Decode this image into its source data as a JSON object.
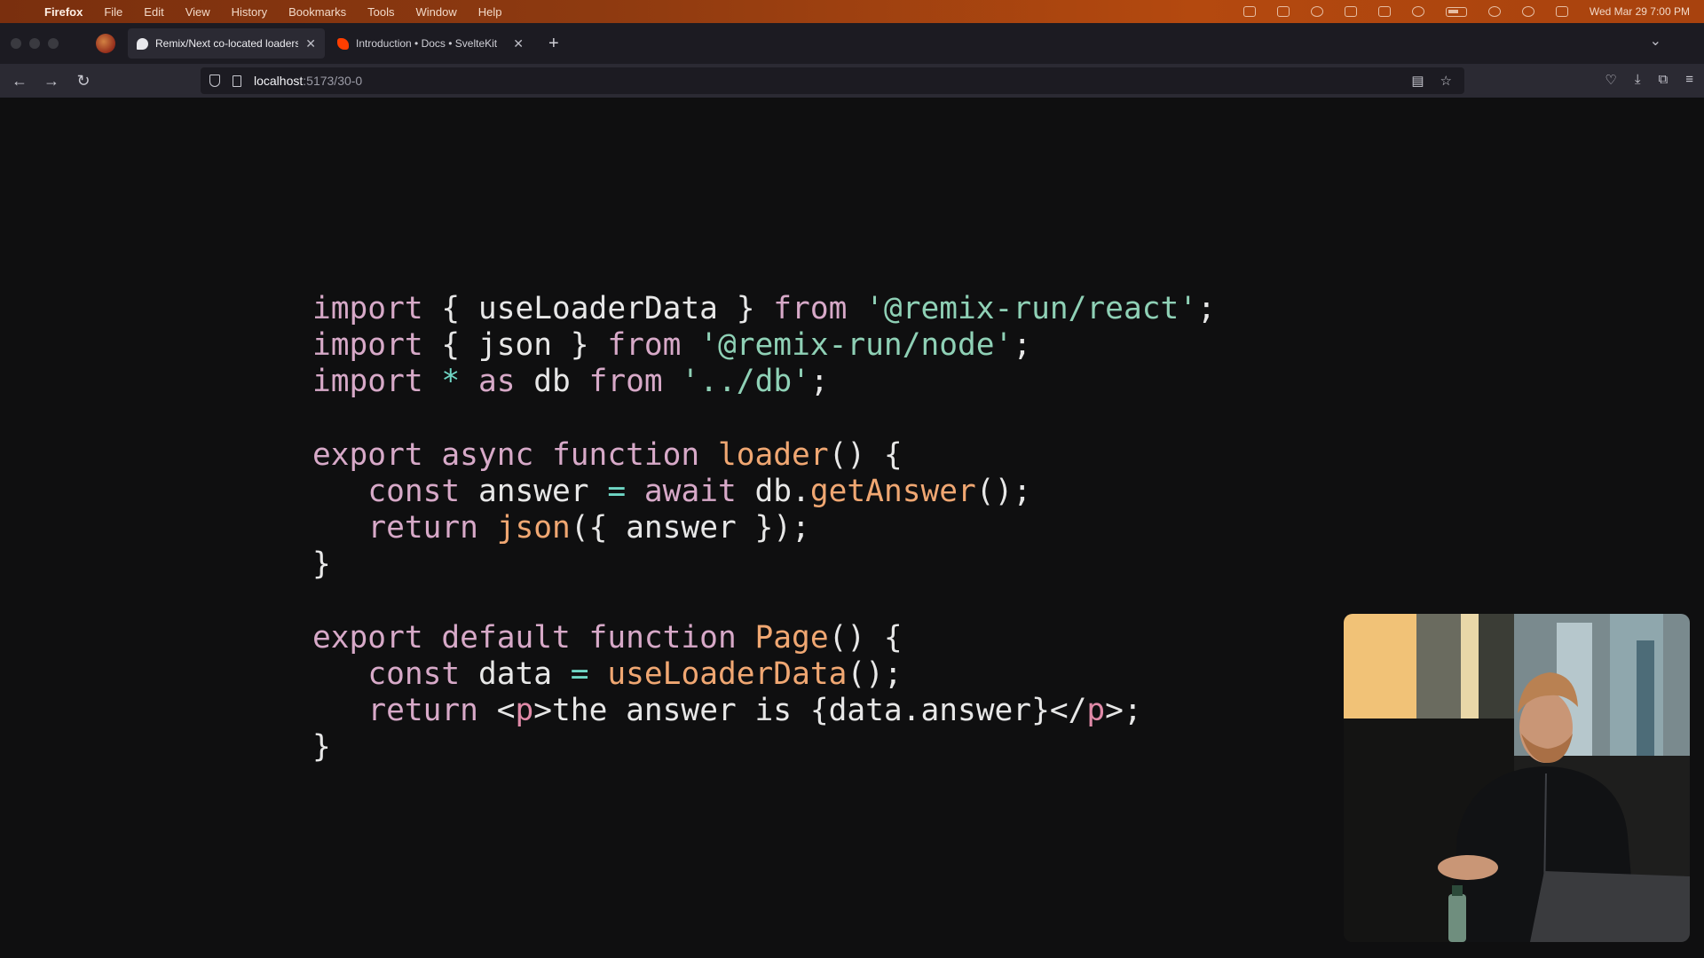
{
  "menubar": {
    "app": "Firefox",
    "items": [
      "File",
      "Edit",
      "View",
      "History",
      "Bookmarks",
      "Tools",
      "Window",
      "Help"
    ],
    "clock": "Wed Mar 29  7:00 PM"
  },
  "tabs": [
    {
      "label": "Remix/Next co-located loaders",
      "active": true
    },
    {
      "label": "Introduction • Docs • SvelteKit",
      "active": false
    }
  ],
  "navbar": {
    "url_host": "localhost",
    "url_path": ":5173/30-0"
  },
  "code": {
    "lines": [
      [
        {
          "t": "import",
          "c": "kw"
        },
        {
          "t": " { useLoaderData } ",
          "c": "pl"
        },
        {
          "t": "from",
          "c": "kw"
        },
        {
          "t": " ",
          "c": "pl"
        },
        {
          "t": "'@remix-run/react'",
          "c": "str"
        },
        {
          "t": ";",
          "c": "pl"
        }
      ],
      [
        {
          "t": "import",
          "c": "kw"
        },
        {
          "t": " { json } ",
          "c": "pl"
        },
        {
          "t": "from",
          "c": "kw"
        },
        {
          "t": " ",
          "c": "pl"
        },
        {
          "t": "'@remix-run/node'",
          "c": "str"
        },
        {
          "t": ";",
          "c": "pl"
        }
      ],
      [
        {
          "t": "import",
          "c": "kw"
        },
        {
          "t": " ",
          "c": "pl"
        },
        {
          "t": "*",
          "c": "op"
        },
        {
          "t": " ",
          "c": "pl"
        },
        {
          "t": "as",
          "c": "kw"
        },
        {
          "t": " db ",
          "c": "pl"
        },
        {
          "t": "from",
          "c": "kw"
        },
        {
          "t": " ",
          "c": "pl"
        },
        {
          "t": "'../db'",
          "c": "str"
        },
        {
          "t": ";",
          "c": "pl"
        }
      ],
      [],
      [
        {
          "t": "export async function",
          "c": "kw"
        },
        {
          "t": " ",
          "c": "pl"
        },
        {
          "t": "loader",
          "c": "fn"
        },
        {
          "t": "() {",
          "c": "pl"
        }
      ],
      [
        {
          "t": "   ",
          "c": "pl"
        },
        {
          "t": "const",
          "c": "kw"
        },
        {
          "t": " answer ",
          "c": "pl"
        },
        {
          "t": "=",
          "c": "op"
        },
        {
          "t": " ",
          "c": "pl"
        },
        {
          "t": "await",
          "c": "kw"
        },
        {
          "t": " db.",
          "c": "pl"
        },
        {
          "t": "getAnswer",
          "c": "fn"
        },
        {
          "t": "();",
          "c": "pl"
        }
      ],
      [
        {
          "t": "   ",
          "c": "pl"
        },
        {
          "t": "return",
          "c": "kw"
        },
        {
          "t": " ",
          "c": "pl"
        },
        {
          "t": "json",
          "c": "fn"
        },
        {
          "t": "({ answer });",
          "c": "pl"
        }
      ],
      [
        {
          "t": "}",
          "c": "pl"
        }
      ],
      [],
      [
        {
          "t": "export default function",
          "c": "kw"
        },
        {
          "t": " ",
          "c": "pl"
        },
        {
          "t": "Page",
          "c": "fn"
        },
        {
          "t": "() {",
          "c": "pl"
        }
      ],
      [
        {
          "t": "   ",
          "c": "pl"
        },
        {
          "t": "const",
          "c": "kw"
        },
        {
          "t": " data ",
          "c": "pl"
        },
        {
          "t": "=",
          "c": "op"
        },
        {
          "t": " ",
          "c": "pl"
        },
        {
          "t": "useLoaderData",
          "c": "fn"
        },
        {
          "t": "();",
          "c": "pl"
        }
      ],
      [
        {
          "t": "   ",
          "c": "pl"
        },
        {
          "t": "return",
          "c": "kw"
        },
        {
          "t": " <",
          "c": "pl"
        },
        {
          "t": "p",
          "c": "tag"
        },
        {
          "t": ">the answer is {data.answer}</",
          "c": "pl"
        },
        {
          "t": "p",
          "c": "tag"
        },
        {
          "t": ">;",
          "c": "pl"
        }
      ],
      [
        {
          "t": "}",
          "c": "pl"
        }
      ]
    ]
  }
}
